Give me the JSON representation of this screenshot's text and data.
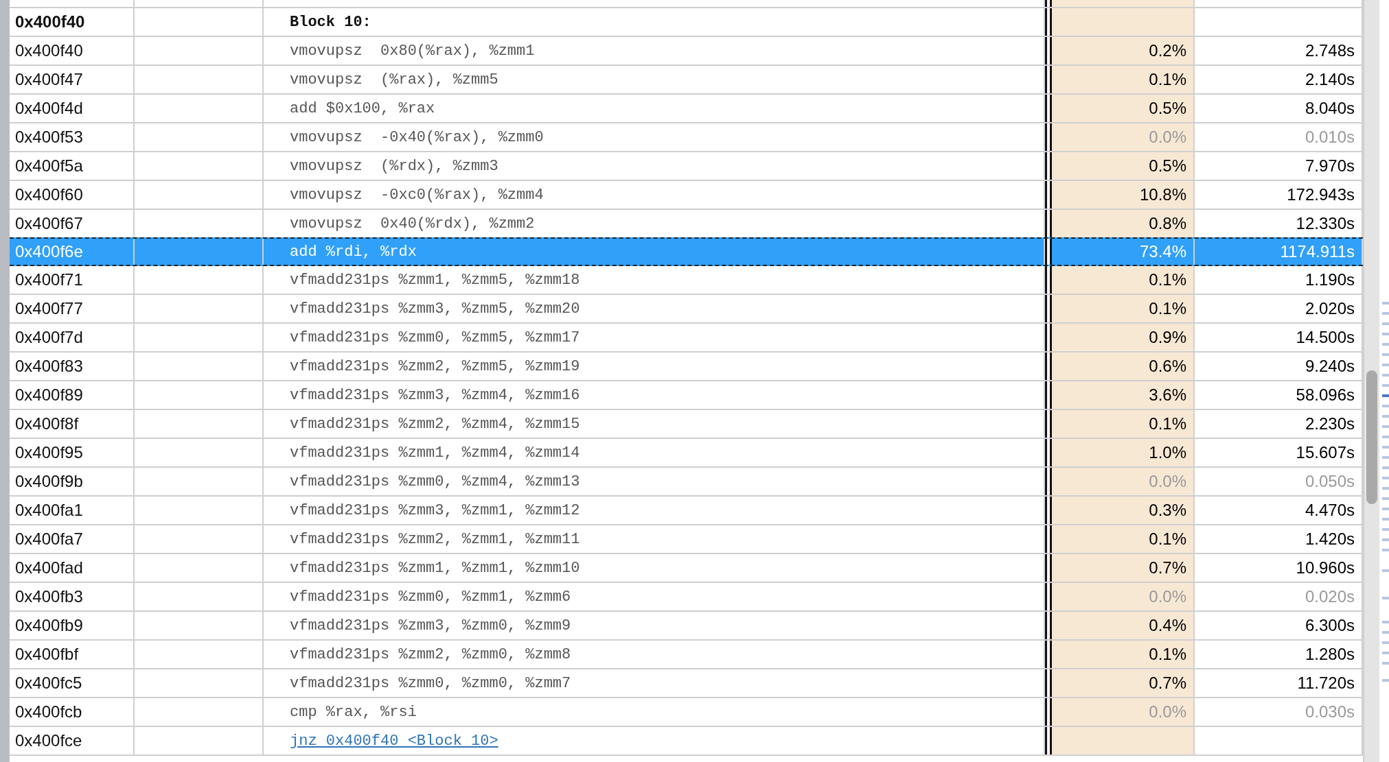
{
  "rows": [
    {
      "kind": "label",
      "address": "0x400f40",
      "instruction": "Block 10:",
      "selected": false
    },
    {
      "kind": "instruction",
      "address": "0x400f40",
      "instruction": "vmovupsz  0x80(%rax), %zmm1",
      "percent": "0.2%",
      "time": "2.748s",
      "selected": false,
      "dimmed": false
    },
    {
      "kind": "instruction",
      "address": "0x400f47",
      "instruction": "vmovupsz  (%rax), %zmm5",
      "percent": "0.1%",
      "time": "2.140s",
      "selected": false,
      "dimmed": false
    },
    {
      "kind": "instruction",
      "address": "0x400f4d",
      "instruction": "add $0x100, %rax",
      "percent": "0.5%",
      "time": "8.040s",
      "selected": false,
      "dimmed": false
    },
    {
      "kind": "instruction",
      "address": "0x400f53",
      "instruction": "vmovupsz  -0x40(%rax), %zmm0",
      "percent": "0.0%",
      "time": "0.010s",
      "selected": false,
      "dimmed": true
    },
    {
      "kind": "instruction",
      "address": "0x400f5a",
      "instruction": "vmovupsz  (%rdx), %zmm3",
      "percent": "0.5%",
      "time": "7.970s",
      "selected": false,
      "dimmed": false
    },
    {
      "kind": "instruction",
      "address": "0x400f60",
      "instruction": "vmovupsz  -0xc0(%rax), %zmm4",
      "percent": "10.8%",
      "time": "172.943s",
      "selected": false,
      "dimmed": false
    },
    {
      "kind": "instruction",
      "address": "0x400f67",
      "instruction": "vmovupsz  0x40(%rdx), %zmm2",
      "percent": "0.8%",
      "time": "12.330s",
      "selected": false,
      "dimmed": false
    },
    {
      "kind": "instruction",
      "address": "0x400f6e",
      "instruction": "add %rdi, %rdx",
      "percent": "73.4%",
      "time": "1174.911s",
      "selected": true,
      "dimmed": false
    },
    {
      "kind": "instruction",
      "address": "0x400f71",
      "instruction": "vfmadd231ps %zmm1, %zmm5, %zmm18",
      "percent": "0.1%",
      "time": "1.190s",
      "selected": false,
      "dimmed": false
    },
    {
      "kind": "instruction",
      "address": "0x400f77",
      "instruction": "vfmadd231ps %zmm3, %zmm5, %zmm20",
      "percent": "0.1%",
      "time": "2.020s",
      "selected": false,
      "dimmed": false
    },
    {
      "kind": "instruction",
      "address": "0x400f7d",
      "instruction": "vfmadd231ps %zmm0, %zmm5, %zmm17",
      "percent": "0.9%",
      "time": "14.500s",
      "selected": false,
      "dimmed": false
    },
    {
      "kind": "instruction",
      "address": "0x400f83",
      "instruction": "vfmadd231ps %zmm2, %zmm5, %zmm19",
      "percent": "0.6%",
      "time": "9.240s",
      "selected": false,
      "dimmed": false
    },
    {
      "kind": "instruction",
      "address": "0x400f89",
      "instruction": "vfmadd231ps %zmm3, %zmm4, %zmm16",
      "percent": "3.6%",
      "time": "58.096s",
      "selected": false,
      "dimmed": false
    },
    {
      "kind": "instruction",
      "address": "0x400f8f",
      "instruction": "vfmadd231ps %zmm2, %zmm4, %zmm15",
      "percent": "0.1%",
      "time": "2.230s",
      "selected": false,
      "dimmed": false
    },
    {
      "kind": "instruction",
      "address": "0x400f95",
      "instruction": "vfmadd231ps %zmm1, %zmm4, %zmm14",
      "percent": "1.0%",
      "time": "15.607s",
      "selected": false,
      "dimmed": false
    },
    {
      "kind": "instruction",
      "address": "0x400f9b",
      "instruction": "vfmadd231ps %zmm0, %zmm4, %zmm13",
      "percent": "0.0%",
      "time": "0.050s",
      "selected": false,
      "dimmed": true
    },
    {
      "kind": "instruction",
      "address": "0x400fa1",
      "instruction": "vfmadd231ps %zmm3, %zmm1, %zmm12",
      "percent": "0.3%",
      "time": "4.470s",
      "selected": false,
      "dimmed": false
    },
    {
      "kind": "instruction",
      "address": "0x400fa7",
      "instruction": "vfmadd231ps %zmm2, %zmm1, %zmm11",
      "percent": "0.1%",
      "time": "1.420s",
      "selected": false,
      "dimmed": false
    },
    {
      "kind": "instruction",
      "address": "0x400fad",
      "instruction": "vfmadd231ps %zmm1, %zmm1, %zmm10",
      "percent": "0.7%",
      "time": "10.960s",
      "selected": false,
      "dimmed": false
    },
    {
      "kind": "instruction",
      "address": "0x400fb3",
      "instruction": "vfmadd231ps %zmm0, %zmm1, %zmm6",
      "percent": "0.0%",
      "time": "0.020s",
      "selected": false,
      "dimmed": true
    },
    {
      "kind": "instruction",
      "address": "0x400fb9",
      "instruction": "vfmadd231ps %zmm3, %zmm0, %zmm9",
      "percent": "0.4%",
      "time": "6.300s",
      "selected": false,
      "dimmed": false
    },
    {
      "kind": "instruction",
      "address": "0x400fbf",
      "instruction": "vfmadd231ps %zmm2, %zmm0, %zmm8",
      "percent": "0.1%",
      "time": "1.280s",
      "selected": false,
      "dimmed": false
    },
    {
      "kind": "instruction",
      "address": "0x400fc5",
      "instruction": "vfmadd231ps %zmm0, %zmm0, %zmm7",
      "percent": "0.7%",
      "time": "11.720s",
      "selected": false,
      "dimmed": false
    },
    {
      "kind": "instruction",
      "address": "0x400fcb",
      "instruction": "cmp %rax, %rsi",
      "percent": "0.0%",
      "time": "0.030s",
      "selected": false,
      "dimmed": true
    },
    {
      "kind": "jump",
      "address": "0x400fce",
      "instruction": "jnz 0x400f40 <Block 10>",
      "selected": false
    }
  ]
}
